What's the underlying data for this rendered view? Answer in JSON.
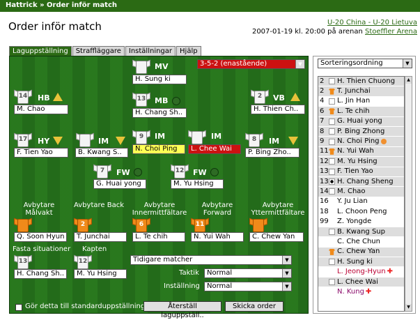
{
  "breadcrumb": "Hattrick » Order inför match",
  "title": "Order inför match",
  "match_link": "U-20 China - U-20 Lietuva",
  "date_prefix": "2007-01-19 kl. 20:00 på arenan",
  "arena_link": "Stoeffler Arena",
  "tabs": [
    "Laguppställning",
    "Straffläggare",
    "Inställningar",
    "Hjälp"
  ],
  "formation": "3-5-2 (enastående)",
  "positions": {
    "mv": {
      "label": "MV",
      "name": "H. Sung ki",
      "num": ""
    },
    "hb": {
      "label": "HB",
      "name": "M. Chao",
      "num": "14"
    },
    "mb": {
      "label": "MB",
      "name": "H. Chang Sh..",
      "num": "13"
    },
    "vb": {
      "label": "VB",
      "name": "H. Thien Ch..",
      "num": "2"
    },
    "hy": {
      "label": "HY",
      "name": "F. Tien Yao",
      "num": "17"
    },
    "im1": {
      "label": "IM",
      "name": "B. Kwang S..",
      "num": ""
    },
    "im2": {
      "label": "IM",
      "name": "N. Choi Ping",
      "num": "9"
    },
    "im3": {
      "label": "IM",
      "name": "L. Chee Wai",
      "num": ""
    },
    "vy": {
      "label": "IM",
      "name": "P. Bing Zho..",
      "num": "8"
    },
    "fw1": {
      "label": "FW",
      "name": "G. Huai yong",
      "num": "7"
    },
    "fw2": {
      "label": "FW",
      "name": "M. Yu Hsing",
      "num": "12"
    }
  },
  "subs_headers": [
    "Avbytare Målvakt",
    "Avbytare Back",
    "Avbytare Innermittfältare",
    "Avbytare Forward",
    "Avbytare Yttermittfältare"
  ],
  "subs": [
    {
      "name": "Q. Soon Hyun",
      "num": ""
    },
    {
      "name": "T. Junchai",
      "num": "2"
    },
    {
      "name": "L. Te chih",
      "num": "6"
    },
    {
      "name": "N. Yui Wah",
      "num": "11"
    },
    {
      "name": "C. Chew Yan",
      "num": ""
    }
  ],
  "set_pieces_label": "Fasta situationer",
  "set_pieces_name": "H. Chang Sh..",
  "set_pieces_num": "13",
  "captain_label": "Kapten",
  "captain_name": "M. Yu Hsing",
  "captain_num": "12",
  "previous_matches": "Tidigare matcher",
  "tactic_label": "Taktik",
  "tactic_value": "Normal",
  "attitude_label": "Inställning",
  "attitude_value": "Normal",
  "default_checkbox_label": "Gör detta till standarduppställning",
  "reset_button": "Återställ laguppställ..",
  "send_button": "Skicka order",
  "sort_label": "Sorteringsordning",
  "roster": [
    {
      "n": "2",
      "icon": "plain",
      "name": "H. Thien Chuong",
      "style": "alt"
    },
    {
      "n": "2",
      "icon": "orng",
      "name": "T. Junchai",
      "style": "alt"
    },
    {
      "n": "4",
      "icon": "plain",
      "name": "L. Jin Han",
      "style": ""
    },
    {
      "n": "6",
      "icon": "orng",
      "name": "L. Te chih",
      "style": "alt"
    },
    {
      "n": "7",
      "icon": "plain",
      "name": "G. Huai yong",
      "style": "alt"
    },
    {
      "n": "8",
      "icon": "plain",
      "name": "P. Bing Zhong",
      "style": "alt"
    },
    {
      "n": "9",
      "icon": "plain",
      "name": "N. Choi Ping",
      "style": "alt",
      "extra": "lock"
    },
    {
      "n": "11",
      "icon": "orng",
      "name": "N. Yui Wah",
      "style": "alt"
    },
    {
      "n": "12",
      "icon": "plain",
      "name": "M. Yu Hsing",
      "style": "alt"
    },
    {
      "n": "13",
      "icon": "plain",
      "name": "F. Tien Yao",
      "style": "alt"
    },
    {
      "n": "13",
      "icon": "dot",
      "name": "H. Chang Sheng",
      "style": "alt"
    },
    {
      "n": "14",
      "icon": "plain",
      "name": "M. Chao",
      "style": "alt"
    },
    {
      "n": "16",
      "icon": "",
      "name": "Y. Ju Lian",
      "style": ""
    },
    {
      "n": "18",
      "icon": "",
      "name": "L. Choon Peng",
      "style": ""
    },
    {
      "n": "99",
      "icon": "",
      "name": "Z. Yongde",
      "style": ""
    },
    {
      "n": "",
      "icon": "plain",
      "name": "B. Kwang Sup",
      "style": "alt"
    },
    {
      "n": "",
      "icon": "",
      "name": "C. Che Chun",
      "style": ""
    },
    {
      "n": "",
      "icon": "orng",
      "name": "C. Chew Yan",
      "style": "alt"
    },
    {
      "n": "",
      "icon": "plain",
      "name": "H. Sung ki",
      "style": "alt"
    },
    {
      "n": "",
      "icon": "",
      "name": "L. Jeong-Hyun",
      "style": "red",
      "extra": "plus"
    },
    {
      "n": "",
      "icon": "plain",
      "name": "L. Chee Wai",
      "style": "alt"
    },
    {
      "n": "",
      "icon": "",
      "name": "N. Kung",
      "style": "purple",
      "extra": "plus"
    }
  ],
  "colors": {
    "pitch": "#236b1a",
    "header": "#2b6a14",
    "selected_red": "#cc1111",
    "selected_yellow": "#ffff55"
  }
}
